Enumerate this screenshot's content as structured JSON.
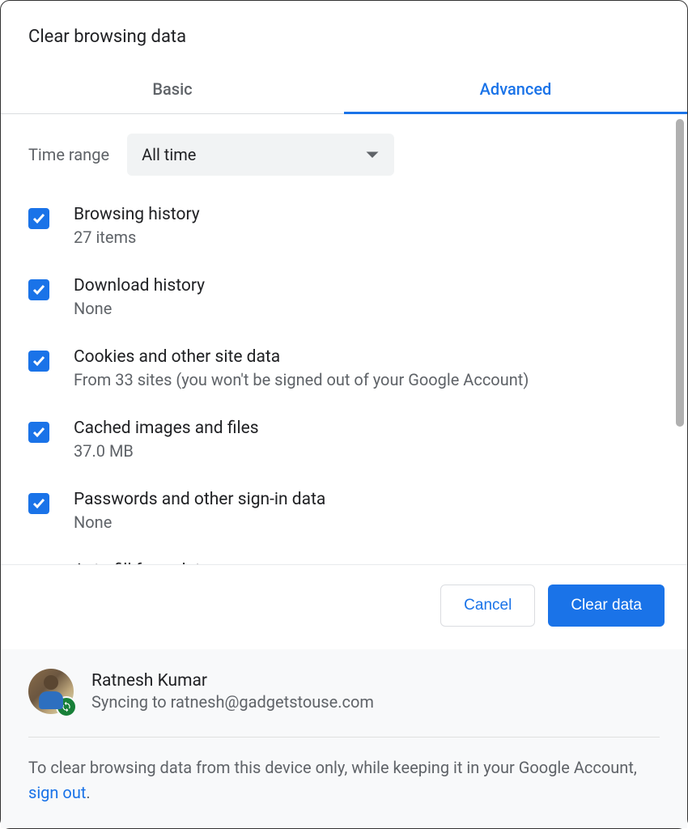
{
  "dialog": {
    "title": "Clear browsing data",
    "tabs": {
      "basic": "Basic",
      "advanced": "Advanced"
    },
    "active_tab": "advanced"
  },
  "time_range": {
    "label": "Time range",
    "selected": "All time"
  },
  "options": [
    {
      "title": "Browsing history",
      "subtitle": "27 items",
      "checked": true
    },
    {
      "title": "Download history",
      "subtitle": "None",
      "checked": true
    },
    {
      "title": "Cookies and other site data",
      "subtitle": "From 33 sites (you won't be signed out of your Google Account)",
      "checked": true
    },
    {
      "title": "Cached images and files",
      "subtitle": "37.0 MB",
      "checked": true
    },
    {
      "title": "Passwords and other sign-in data",
      "subtitle": "None",
      "checked": true
    },
    {
      "title": "Auto-fill form data",
      "subtitle": "",
      "checked": true
    }
  ],
  "buttons": {
    "cancel": "Cancel",
    "clear": "Clear data"
  },
  "account": {
    "name": "Ratnesh Kumar",
    "sync_status": "Syncing to ratnesh@gadgetstouse.com"
  },
  "signout_note": {
    "prefix": "To clear browsing data from this device only, while keeping it in your Google Account, ",
    "link": "sign out",
    "suffix": "."
  }
}
